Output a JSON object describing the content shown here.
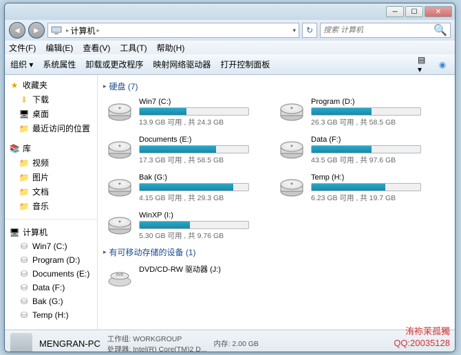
{
  "breadcrumb": {
    "computer": "计算机"
  },
  "search": {
    "placeholder": "搜索 计算机"
  },
  "menu": {
    "file": "文件(F)",
    "edit": "编辑(E)",
    "view": "查看(V)",
    "tools": "工具(T)",
    "help": "帮助(H)"
  },
  "toolbar": {
    "organize": "组织",
    "properties": "系统属性",
    "uninstall": "卸载或更改程序",
    "map": "映射网络驱动器",
    "control": "打开控制面板"
  },
  "sidebar": {
    "favorites": "收藏夹",
    "fav_items": {
      "downloads": "下载",
      "desktop": "桌面",
      "recent": "最近访问的位置"
    },
    "libraries": "库",
    "lib_items": {
      "videos": "视频",
      "pictures": "图片",
      "documents": "文档",
      "music": "音乐"
    },
    "computer": "计算机",
    "drives": {
      "c": "Win7 (C:)",
      "d": "Program (D:)",
      "e": "Documents (E:)",
      "f": "Data (F:)",
      "g": "Bak (G:)",
      "h": "Temp (H:)"
    }
  },
  "sections": {
    "hdd": "硬盘 (7)",
    "removable": "有可移动存储的设备 (1)"
  },
  "drives": [
    {
      "name": "Win7 (C:)",
      "text": "13.9 GB 可用 , 共 24.3 GB",
      "fill": 43
    },
    {
      "name": "Program (D:)",
      "text": "26.3 GB 可用 , 共 58.5 GB",
      "fill": 55
    },
    {
      "name": "Documents (E:)",
      "text": "17.3 GB 可用 , 共 58.5 GB",
      "fill": 70
    },
    {
      "name": "Data (F:)",
      "text": "43.5 GB 可用 , 共 97.6 GB",
      "fill": 55
    },
    {
      "name": "Bak (G:)",
      "text": "4.15 GB 可用 , 共 29.3 GB",
      "fill": 86
    },
    {
      "name": "Temp (H:)",
      "text": "6.23 GB 可用 , 共 19.7 GB",
      "fill": 68
    },
    {
      "name": "WinXP (I:)",
      "text": "5.30 GB 可用 , 共 9.76 GB",
      "fill": 46
    }
  ],
  "dvd": {
    "name": "DVD/CD-RW 驱动器 (J:)"
  },
  "status": {
    "name": "MENGRAN-PC",
    "workgroup_label": "工作组:",
    "workgroup": "WORKGROUP",
    "mem_label": "内存:",
    "mem": "2.00 GB",
    "cpu_label": "处理器:",
    "cpu": "Intel(R) Core(TM)2 D..."
  },
  "watermark": {
    "line1": "洧袮茉孤獨",
    "line2": "QQ:20035128"
  }
}
